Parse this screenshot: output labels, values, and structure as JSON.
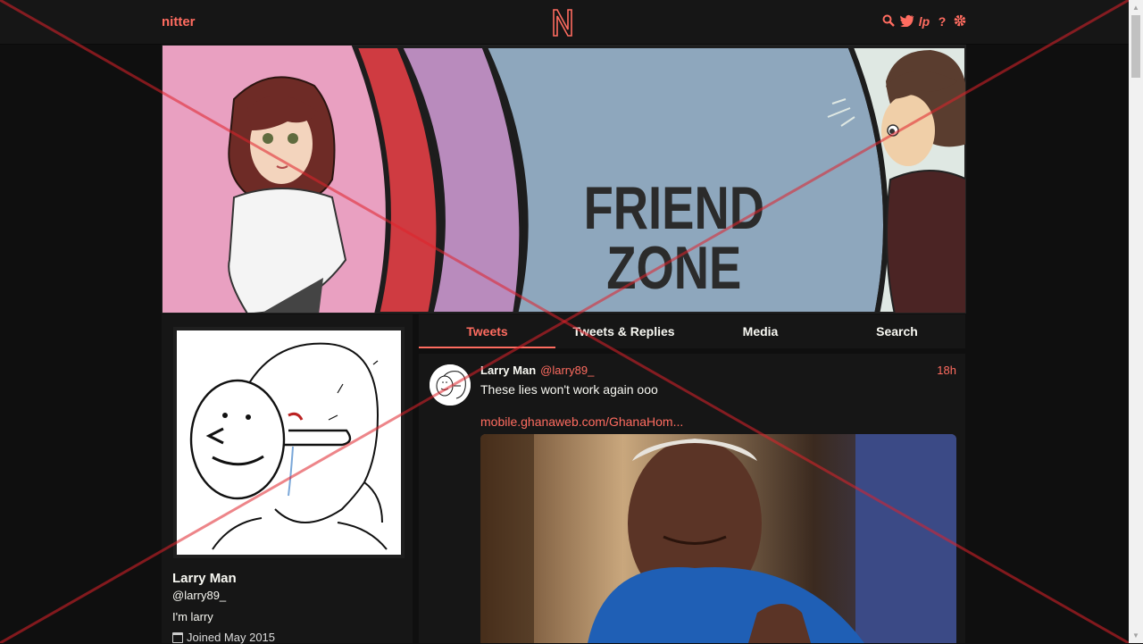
{
  "nav": {
    "brand": "nitter",
    "icons": [
      "search-icon",
      "twitter-icon",
      "liberapay-icon",
      "help-icon",
      "gear-icon"
    ]
  },
  "banner": {
    "text_line1": "FRIEND",
    "text_line2": "ZONE"
  },
  "profile": {
    "name": "Larry Man",
    "username": "@larry89_",
    "bio": "I'm larry",
    "joined": "Joined May 2015"
  },
  "tabs": [
    {
      "label": "Tweets",
      "active": true
    },
    {
      "label": "Tweets & Replies",
      "active": false
    },
    {
      "label": "Media",
      "active": false
    },
    {
      "label": "Search",
      "active": false
    }
  ],
  "tweet": {
    "name": "Larry Man",
    "username": "@larry89_",
    "time": "18h",
    "text": "These lies won't work again ooo",
    "link": "mobile.ghanaweb.com/GhanaHom..."
  },
  "colors": {
    "accent": "#ff6c60",
    "background": "#0f0f0f",
    "panel": "#161616"
  }
}
